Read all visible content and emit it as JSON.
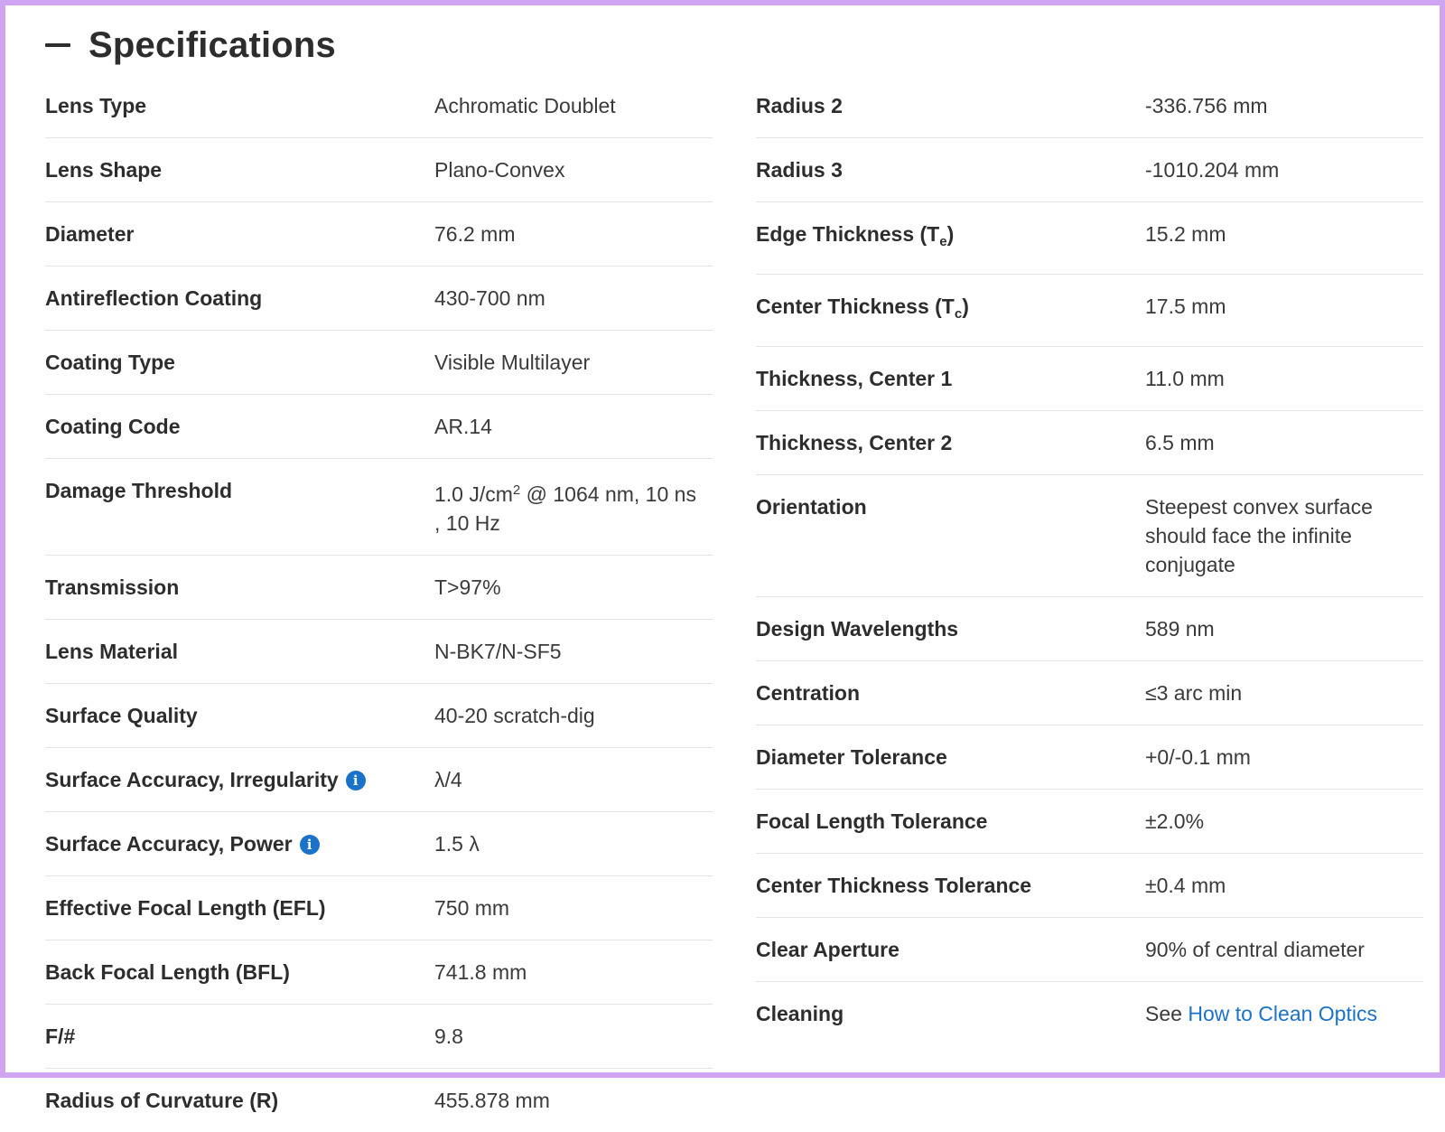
{
  "header": {
    "title": "Specifications"
  },
  "left": [
    {
      "label": "Lens Type",
      "value": "Achromatic Doublet"
    },
    {
      "label": "Lens Shape",
      "value": "Plano-Convex"
    },
    {
      "label": "Diameter",
      "value": "76.2 mm"
    },
    {
      "label": "Antireflection Coating",
      "value": "430-700 nm"
    },
    {
      "label": "Coating Type",
      "value": "Visible Multilayer"
    },
    {
      "label": "Coating Code",
      "value": "AR.14"
    },
    {
      "label": "Damage Threshold",
      "value_pre": "1.0 J/cm",
      "value_sup": "2",
      "value_post": " @ 1064 nm, 10 ns , 10 Hz"
    },
    {
      "label": "Transmission",
      "value": "T>97%"
    },
    {
      "label": "Lens Material",
      "value": "N-BK7/N-SF5"
    },
    {
      "label": "Surface Quality",
      "value": "40-20 scratch-dig"
    },
    {
      "label": "Surface Accuracy, Irregularity",
      "value": "λ/4",
      "info_icon": "i"
    },
    {
      "label": "Surface Accuracy, Power",
      "value": "1.5 λ",
      "info_icon": "i"
    },
    {
      "label": "Effective Focal Length (EFL)",
      "value": "750 mm"
    },
    {
      "label": "Back Focal Length (BFL)",
      "value": "741.8 mm"
    },
    {
      "label": "F/#",
      "value": "9.8"
    },
    {
      "label": "Radius of Curvature (R)",
      "value": "455.878 mm"
    }
  ],
  "right": [
    {
      "label": "Radius 2",
      "value": "-336.756 mm"
    },
    {
      "label": "Radius 3",
      "value": "-1010.204 mm"
    },
    {
      "label_pre": "Edge Thickness (T",
      "label_sub": "e",
      "label_post": ")",
      "value": "15.2 mm"
    },
    {
      "label_pre": "Center Thickness (T",
      "label_sub": "c",
      "label_post": ")",
      "value": "17.5 mm"
    },
    {
      "label": "Thickness, Center 1",
      "value": "11.0 mm"
    },
    {
      "label": "Thickness, Center 2",
      "value": "6.5 mm"
    },
    {
      "label": "Orientation",
      "value": "Steepest convex surface should face the infinite conjugate"
    },
    {
      "label": "Design Wavelengths",
      "value": "589 nm"
    },
    {
      "label": "Centration",
      "value": "≤3 arc min"
    },
    {
      "label": "Diameter Tolerance",
      "value": "+0/-0.1 mm"
    },
    {
      "label": "Focal Length Tolerance",
      "value": "±2.0%"
    },
    {
      "label": "Center Thickness Tolerance",
      "value": "±0.4 mm"
    },
    {
      "label": "Clear Aperture",
      "value": "90% of central diameter"
    },
    {
      "label": "Cleaning",
      "value": "See ",
      "link": "How to Clean Optics"
    }
  ],
  "colors": {
    "accent": "#1a73c8",
    "frame": "#cfa5f2",
    "divider": "#e3e3e3"
  },
  "icons": {
    "collapse": "minus-icon",
    "info": "info-icon"
  }
}
